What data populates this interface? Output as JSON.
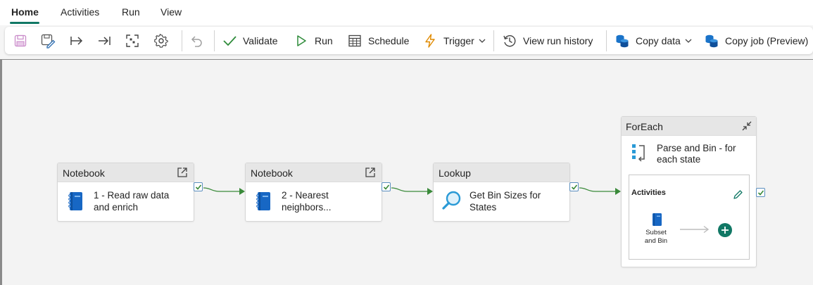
{
  "tabs": [
    {
      "label": "Home"
    },
    {
      "label": "Activities"
    },
    {
      "label": "Run"
    },
    {
      "label": "View"
    }
  ],
  "toolbar": {
    "validate": "Validate",
    "run": "Run",
    "schedule": "Schedule",
    "trigger": "Trigger",
    "view_run_history": "View run history",
    "copy_data": "Copy data",
    "copy_job": "Copy job (Preview)"
  },
  "colors": {
    "accent": "#117865",
    "success": "#3a8a3a",
    "notebook_blue": "#1767c4",
    "lookup_blue": "#2a9ad6"
  },
  "pipeline": {
    "activities": [
      {
        "type": "Notebook",
        "name_line1": "1 - Read raw data",
        "name_line2": "and enrich",
        "icon": "notebook-icon"
      },
      {
        "type": "Notebook",
        "name_line1": "2 - Nearest",
        "name_line2": "neighbors...",
        "icon": "notebook-icon"
      },
      {
        "type": "Lookup",
        "name_line1": "Get Bin Sizes for",
        "name_line2": "States",
        "icon": "magnifier-icon"
      }
    ],
    "foreach": {
      "type": "ForEach",
      "name_line1": "Parse and Bin - for",
      "name_line2": "each state",
      "inner_title": "Activities",
      "inner_activity_line1": "Subset",
      "inner_activity_line2": "and Bin"
    }
  }
}
